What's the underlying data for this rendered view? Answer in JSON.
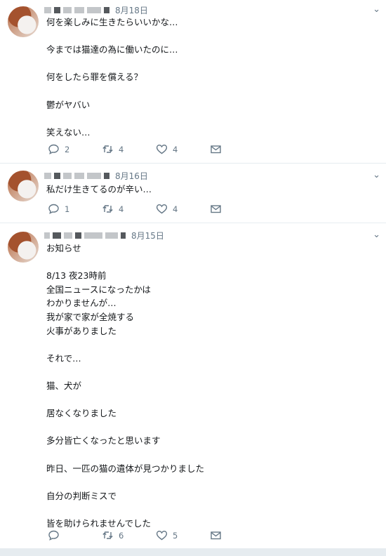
{
  "tweets": [
    {
      "date": "8月18日",
      "text": "何を楽しみに生きたらいいかな…\n\n今までは猫達の為に働いたのに…\n\n何をしたら罪を償える？\n\n鬱がヤバい\n\n笑えない…",
      "replies": "2",
      "retweets": "4",
      "likes": "4"
    },
    {
      "date": "8月16日",
      "text": "私だけ生きてるのが辛い…",
      "replies": "1",
      "retweets": "4",
      "likes": "4"
    },
    {
      "date": "8月15日",
      "text": "お知らせ\n\n8/13 夜23時前\n全国ニュースになったかは\nわかりませんが…\n我が家で家が全焼する\n火事がありました\n\nそれで…\n\n猫、犬が\n\n居なくなりました\n\n多分皆亡くなったと思います\n\n昨日、一匹の猫の遺体が見つかりました\n\n自分の判断ミスで\n\n皆を助けられませんでした",
      "replies": "",
      "retweets": "6",
      "likes": "5"
    }
  ],
  "icons": {
    "caret": "chevron-down-icon",
    "reply": "reply-icon",
    "retweet": "retweet-icon",
    "like": "heart-icon",
    "dm": "envelope-icon"
  },
  "colors": {
    "icon_gray": "#657786",
    "divider": "#e6ecf0"
  }
}
